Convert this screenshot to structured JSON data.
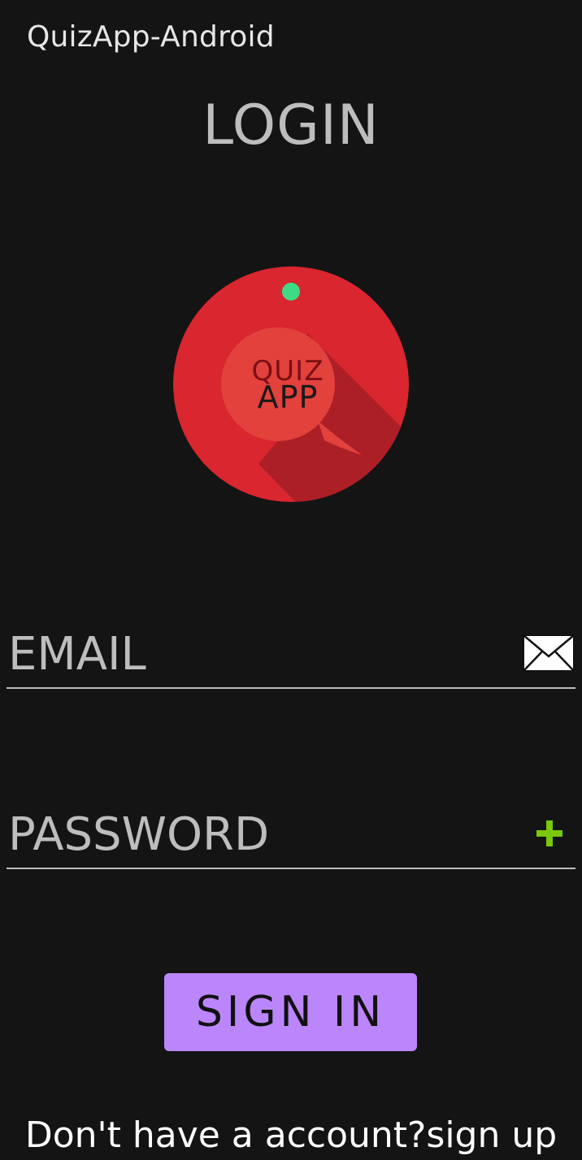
{
  "app": {
    "title": "QuizApp-Android"
  },
  "screen": {
    "heading": "LOGIN"
  },
  "logo": {
    "line1": "QUIZ",
    "line2": "APP",
    "icon": "quiz-app-logo",
    "colors": {
      "outer": "#d9262f",
      "inner": "#e2413c",
      "shadow": "#ad1f27",
      "dot": "#3ddc84"
    }
  },
  "form": {
    "email": {
      "placeholder": "EMAIL",
      "icon": "mail-icon"
    },
    "password": {
      "placeholder": "PASSWORD",
      "icon": "plus-icon"
    },
    "submit_label": "SIGN IN"
  },
  "footer": {
    "signup_text": "Don't have a account?sign up"
  },
  "colors": {
    "background": "#141414",
    "accent": "#bb86fc",
    "text_muted": "#bdbdbd",
    "plus_icon": "#7ac70c"
  }
}
